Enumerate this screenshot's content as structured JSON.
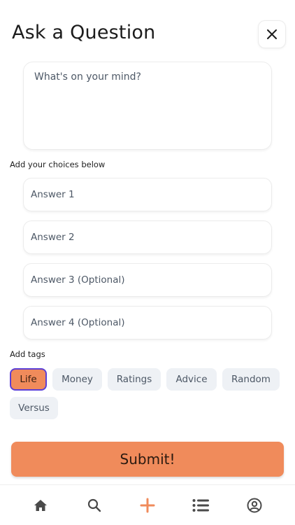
{
  "header": {
    "title": "Ask a Question",
    "close_icon": "close-icon"
  },
  "question": {
    "placeholder": "What's on your mind?",
    "value": ""
  },
  "choices": {
    "label": "Add your choices below",
    "answers": [
      {
        "placeholder": "Answer 1",
        "value": ""
      },
      {
        "placeholder": "Answer 2",
        "value": ""
      },
      {
        "placeholder": "Answer 3 (Optional)",
        "value": ""
      },
      {
        "placeholder": "Answer 4 (Optional)",
        "value": ""
      }
    ]
  },
  "tags": {
    "label": "Add tags",
    "items": [
      {
        "label": "Life",
        "selected": true
      },
      {
        "label": "Money",
        "selected": false
      },
      {
        "label": "Ratings",
        "selected": false
      },
      {
        "label": "Advice",
        "selected": false
      },
      {
        "label": "Random",
        "selected": false
      },
      {
        "label": "Versus",
        "selected": false
      }
    ]
  },
  "submit": {
    "label": "Submit!"
  },
  "bottom_nav": {
    "items": [
      {
        "icon": "home-icon",
        "active": false
      },
      {
        "icon": "search-icon",
        "active": false
      },
      {
        "icon": "plus-icon",
        "active": true
      },
      {
        "icon": "list-icon",
        "active": false
      },
      {
        "icon": "profile-icon",
        "active": false
      }
    ]
  },
  "colors": {
    "accent": "#f08b5b",
    "selected_border": "#5b3fd6",
    "tag_bg": "#eef1f5",
    "icon_gray": "#4a4a4a"
  }
}
